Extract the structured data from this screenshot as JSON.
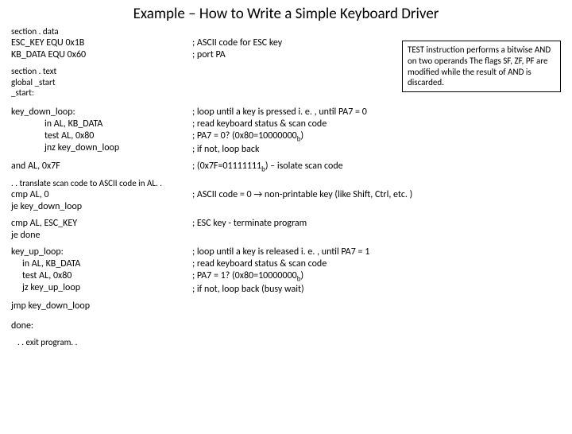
{
  "title": "Example – How to Write a Simple Keyboard Driver",
  "callout": "TEST instruction performs a bitwise AND on two operands The flags SF, ZF, PF are modified while the result of AND is discarded.",
  "sec_data": "section . data",
  "esc_key": "ESC_KEY EQU 0x1B",
  "kb_data": "KB_DATA  EQU 0x60",
  "c_esc": "; ASCII code for ESC key",
  "c_port": "; port PA",
  "sec_text": "section . text",
  "global": "global _start",
  "start": "_start:",
  "kdl": "key_down_loop:",
  "kdl_in": "in AL, KB_DATA",
  "kdl_test": "test AL, 0x80",
  "kdl_jnz": "jnz key_down_loop",
  "c_kdl1": "; loop until a key is pressed i. e. , until PA7 = 0",
  "c_kdl2": "; read keyboard status & scan code",
  "c_kdl3_a": "; PA7 = 0? (0x80=10000000",
  "c_kdl3_b": ")",
  "c_kdl4": "; if not, loop back",
  "and": "and AL, 0x7F",
  "c_and_a": "; (0x7F=01111111",
  "c_and_b": ") – isolate scan code",
  "translate": ". . translate scan code to ASCII code in AL. .",
  "cmp0": "cmp AL, 0",
  "je_kdl": "je key_down_loop",
  "c_cmp0": "; ASCII code = 0 → non-printable key (like Shift, Ctrl, etc. )",
  "cmp_esc": "cmp AL, ESC_KEY",
  "je_done": "je done",
  "c_esc2": "; ESC key - terminate program",
  "kul": "key_up_loop:",
  "kul_in": "in AL, KB_DATA",
  "kul_test": "test AL, 0x80",
  "kul_jz": "jz key_up_loop",
  "c_kul1": "; loop until a key is released i. e. , until PA7 = 1",
  "c_kul2": "; read keyboard status & scan code",
  "c_kul3_a": "; PA7 = 1? (0x80=10000000",
  "c_kul3_b": ")",
  "c_kul4": "; if not, loop back (busy wait)",
  "jmp": "jmp key_down_loop",
  "done": "done:",
  "exit": ". . exit program. ."
}
